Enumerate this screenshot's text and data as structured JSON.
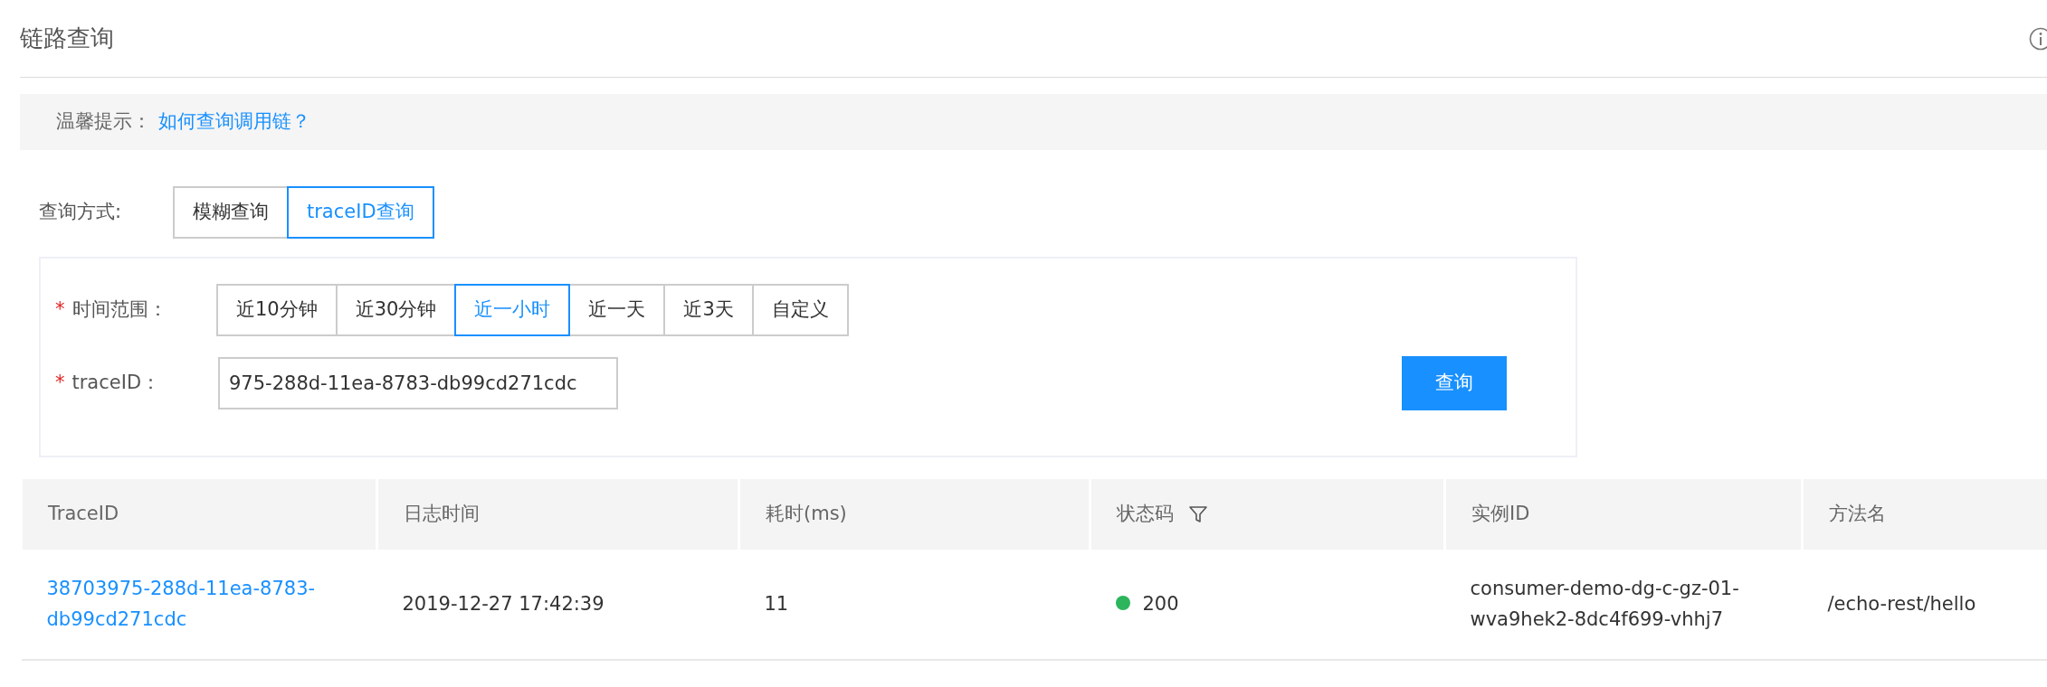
{
  "page": {
    "title": "链路查询"
  },
  "tip": {
    "label": "温馨提示：",
    "link": "如何查询调用链？"
  },
  "query_mode": {
    "label": "查询方式:",
    "options": [
      {
        "label": "模糊查询",
        "selected": false
      },
      {
        "label": "traceID查询",
        "selected": true
      }
    ]
  },
  "form": {
    "time_range": {
      "label": "时间范围：",
      "required_mark": "*",
      "options": [
        {
          "label": "近10分钟",
          "selected": false
        },
        {
          "label": "近30分钟",
          "selected": false
        },
        {
          "label": "近一小时",
          "selected": true
        },
        {
          "label": "近一天",
          "selected": false
        },
        {
          "label": "近3天",
          "selected": false
        },
        {
          "label": "自定义",
          "selected": false
        }
      ]
    },
    "trace_id": {
      "label": "traceID：",
      "required_mark": "*",
      "value": "975-288d-11ea-8783-db99cd271cdc"
    },
    "submit": "查询"
  },
  "table": {
    "columns": [
      {
        "label": "TraceID",
        "filter": false
      },
      {
        "label": "日志时间",
        "filter": false
      },
      {
        "label": "耗时(ms)",
        "filter": false
      },
      {
        "label": "状态码",
        "filter": true
      },
      {
        "label": "实例ID",
        "filter": false
      },
      {
        "label": "方法名",
        "filter": false
      }
    ],
    "rows": [
      {
        "trace_id": "38703975-288d-11ea-8783-db99cd271cdc",
        "time": "2019-12-27 17:42:39",
        "duration": "11",
        "status": {
          "code": "200",
          "color": "#2db55d"
        },
        "instance": "consumer-demo-dg-c-gz-01-wva9hek2-8dc4f699-vhhj7",
        "method": "/echo-rest/hello"
      }
    ]
  }
}
